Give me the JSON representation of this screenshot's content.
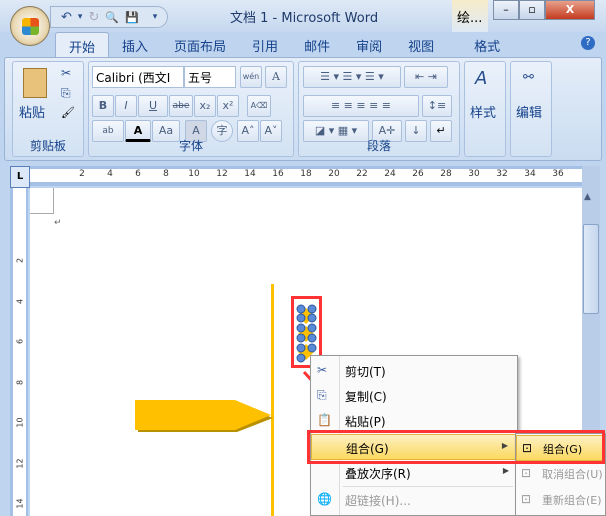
{
  "window": {
    "title": "文档 1 - Microsoft Word",
    "context_tab": "绘...",
    "minimize": "–",
    "restore": "▫",
    "close": "X"
  },
  "qat": {
    "undo": "↶",
    "undo_dd": "▾",
    "redo": "↻",
    "preview": "🔍",
    "save": "💾",
    "customize": "▾"
  },
  "tabs": [
    "开始",
    "插入",
    "页面布局",
    "引用",
    "邮件",
    "审阅",
    "视图",
    "格式"
  ],
  "help": "?",
  "ribbon": {
    "clipboard": {
      "label": "剪贴板",
      "paste": "粘贴",
      "cut": "✂",
      "copy": "⎘",
      "painter": "🖌"
    },
    "font": {
      "label": "字体",
      "name": "Calibri (西文I",
      "size": "五号",
      "phonetic": "wén",
      "char_border": "A",
      "bold": "B",
      "italic": "I",
      "underline": "U",
      "strike": "abe",
      "sub": "x₂",
      "sup": "x²",
      "clear": "A⌫",
      "highlight": "ab",
      "color": "A",
      "case": "Aa",
      "shading": "A",
      "enclose": "字",
      "grow": "A˄",
      "shrink": "A˅"
    },
    "paragraph": {
      "label": "段落"
    },
    "styles": {
      "label": "样式"
    },
    "editing": {
      "label": "编辑"
    }
  },
  "ruler": {
    "h_ticks": [
      "2",
      "4",
      "6",
      "8",
      "10",
      "12",
      "14",
      "16",
      "18",
      "20",
      "22",
      "24",
      "26",
      "28",
      "30",
      "32",
      "34",
      "36"
    ],
    "v_ticks": [
      "2",
      "4",
      "6",
      "8",
      "10",
      "12",
      "14"
    ],
    "corner": "L"
  },
  "doc": {
    "para_mark": "↵"
  },
  "context_menu": {
    "items": [
      {
        "label": "剪切(T)",
        "icon": "✂"
      },
      {
        "label": "复制(C)",
        "icon": "⎘"
      },
      {
        "label": "粘贴(P)",
        "icon": "📋"
      },
      {
        "label": "组合(G)",
        "icon": "",
        "submenu": "▶"
      },
      {
        "label": "叠放次序(R)",
        "icon": "",
        "submenu": "▶"
      },
      {
        "label": "超链接(H)...",
        "icon": "🌐"
      }
    ]
  },
  "submenu": {
    "items": [
      {
        "label": "组合(G)"
      },
      {
        "label": "取消组合(U)"
      },
      {
        "label": "重新组合(E)"
      }
    ]
  },
  "colors": {
    "shape": "#ffc000",
    "highlight_box": "#ff3333"
  }
}
